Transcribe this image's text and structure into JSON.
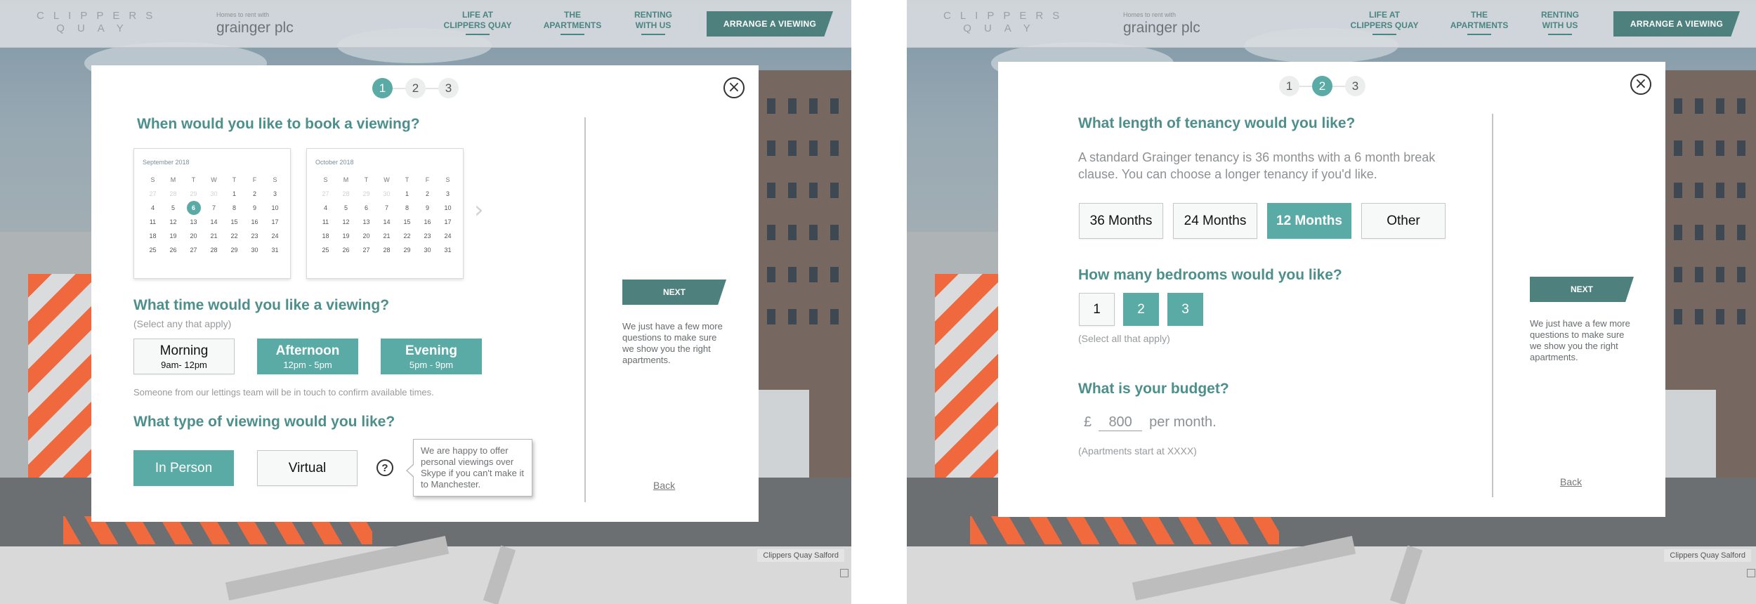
{
  "header": {
    "logo_line1": "CLIPPERS",
    "logo_line2": "QUAY",
    "grainger_tagline": "Homes to rent with",
    "grainger_name": "grainger plc",
    "nav_items": [
      {
        "line1": "LIFE AT",
        "line2": "CLIPPERS QUAY"
      },
      {
        "line1": "THE",
        "line2": "APARTMENTS"
      },
      {
        "line1": "RENTING",
        "line2": "WITH US"
      }
    ],
    "cta": "ARRANGE A VIEWING"
  },
  "map_label": "Clippers Quay Salford",
  "steps": [
    "1",
    "2",
    "3"
  ],
  "close_glyph": "×",
  "sidebar": {
    "next_label": "NEXT",
    "note": "We just have a few more questions to make sure we show you the right apartments.",
    "back_label": "Back"
  },
  "step1": {
    "active_step": 1,
    "date_question": "When would you like to book a viewing?",
    "calendars": [
      {
        "title": "September 2018",
        "weekdays": [
          "S",
          "M",
          "T",
          "W",
          "T",
          "F",
          "S"
        ],
        "weeks": [
          [
            "27",
            "28",
            "29",
            "30",
            "1",
            "2",
            "3"
          ],
          [
            "4",
            "5",
            "6",
            "7",
            "8",
            "9",
            "10"
          ],
          [
            "11",
            "12",
            "13",
            "14",
            "15",
            "16",
            "17"
          ],
          [
            "18",
            "19",
            "20",
            "21",
            "22",
            "23",
            "24"
          ],
          [
            "25",
            "26",
            "27",
            "28",
            "29",
            "30",
            "31"
          ]
        ],
        "dim_cells": [
          0,
          1,
          2,
          3
        ],
        "selected_cell": 9
      },
      {
        "title": "October 2018",
        "weekdays": [
          "S",
          "M",
          "T",
          "W",
          "T",
          "F",
          "S"
        ],
        "weeks": [
          [
            "27",
            "28",
            "29",
            "30",
            "1",
            "2",
            "3"
          ],
          [
            "4",
            "5",
            "6",
            "7",
            "8",
            "9",
            "10"
          ],
          [
            "11",
            "12",
            "13",
            "14",
            "15",
            "16",
            "17"
          ],
          [
            "18",
            "19",
            "20",
            "21",
            "22",
            "23",
            "24"
          ],
          [
            "25",
            "26",
            "27",
            "28",
            "29",
            "30",
            "31"
          ]
        ],
        "dim_cells": [
          0,
          1,
          2,
          3
        ],
        "selected_cell": -1
      }
    ],
    "next_month_glyph": "›",
    "time_question": "What time would you like a viewing?",
    "time_hint": "(Select any that apply)",
    "time_options": [
      {
        "label": "Morning",
        "sub": "9am- 12pm",
        "selected": false
      },
      {
        "label": "Afternoon",
        "sub": "12pm - 5pm",
        "selected": true
      },
      {
        "label": "Evening",
        "sub": "5pm - 9pm",
        "selected": true
      }
    ],
    "team_note": "Someone from our lettings team will be in touch to confirm available times.",
    "type_question": "What type of viewing would you like?",
    "type_options": [
      {
        "label": "In Person",
        "selected": true
      },
      {
        "label": "Virtual",
        "selected": false
      }
    ],
    "help_glyph": "?",
    "tooltip": "We are happy to offer personal viewings over Skype if you can't make it to Manchester."
  },
  "step2": {
    "active_step": 2,
    "tenancy_question": "What length of tenancy would you like?",
    "tenancy_desc": "A standard Grainger tenancy is 36 months with a 6 month break clause. You can choose a longer tenancy if you'd like.",
    "tenancy_options": [
      {
        "label": "36 Months",
        "selected": false
      },
      {
        "label": "24 Months",
        "selected": false
      },
      {
        "label": "12 Months",
        "selected": true
      },
      {
        "label": "Other",
        "selected": false
      }
    ],
    "bedroom_question": "How many bedrooms would you like?",
    "bedroom_options": [
      {
        "label": "1",
        "selected": false
      },
      {
        "label": "2",
        "selected": true
      },
      {
        "label": "3",
        "selected": true
      }
    ],
    "bedroom_hint": "(Select all that apply)",
    "budget_question": "What is your budget?",
    "currency": "£",
    "budget_value": "800",
    "budget_suffix": "per month.",
    "budget_hint": "(Apartments start at XXXX)"
  },
  "colors": {
    "accent": "#5aaaa6",
    "dark_teal": "#4e817e",
    "heading": "#4d8f8b",
    "hazard_orange": "#f0683e"
  }
}
